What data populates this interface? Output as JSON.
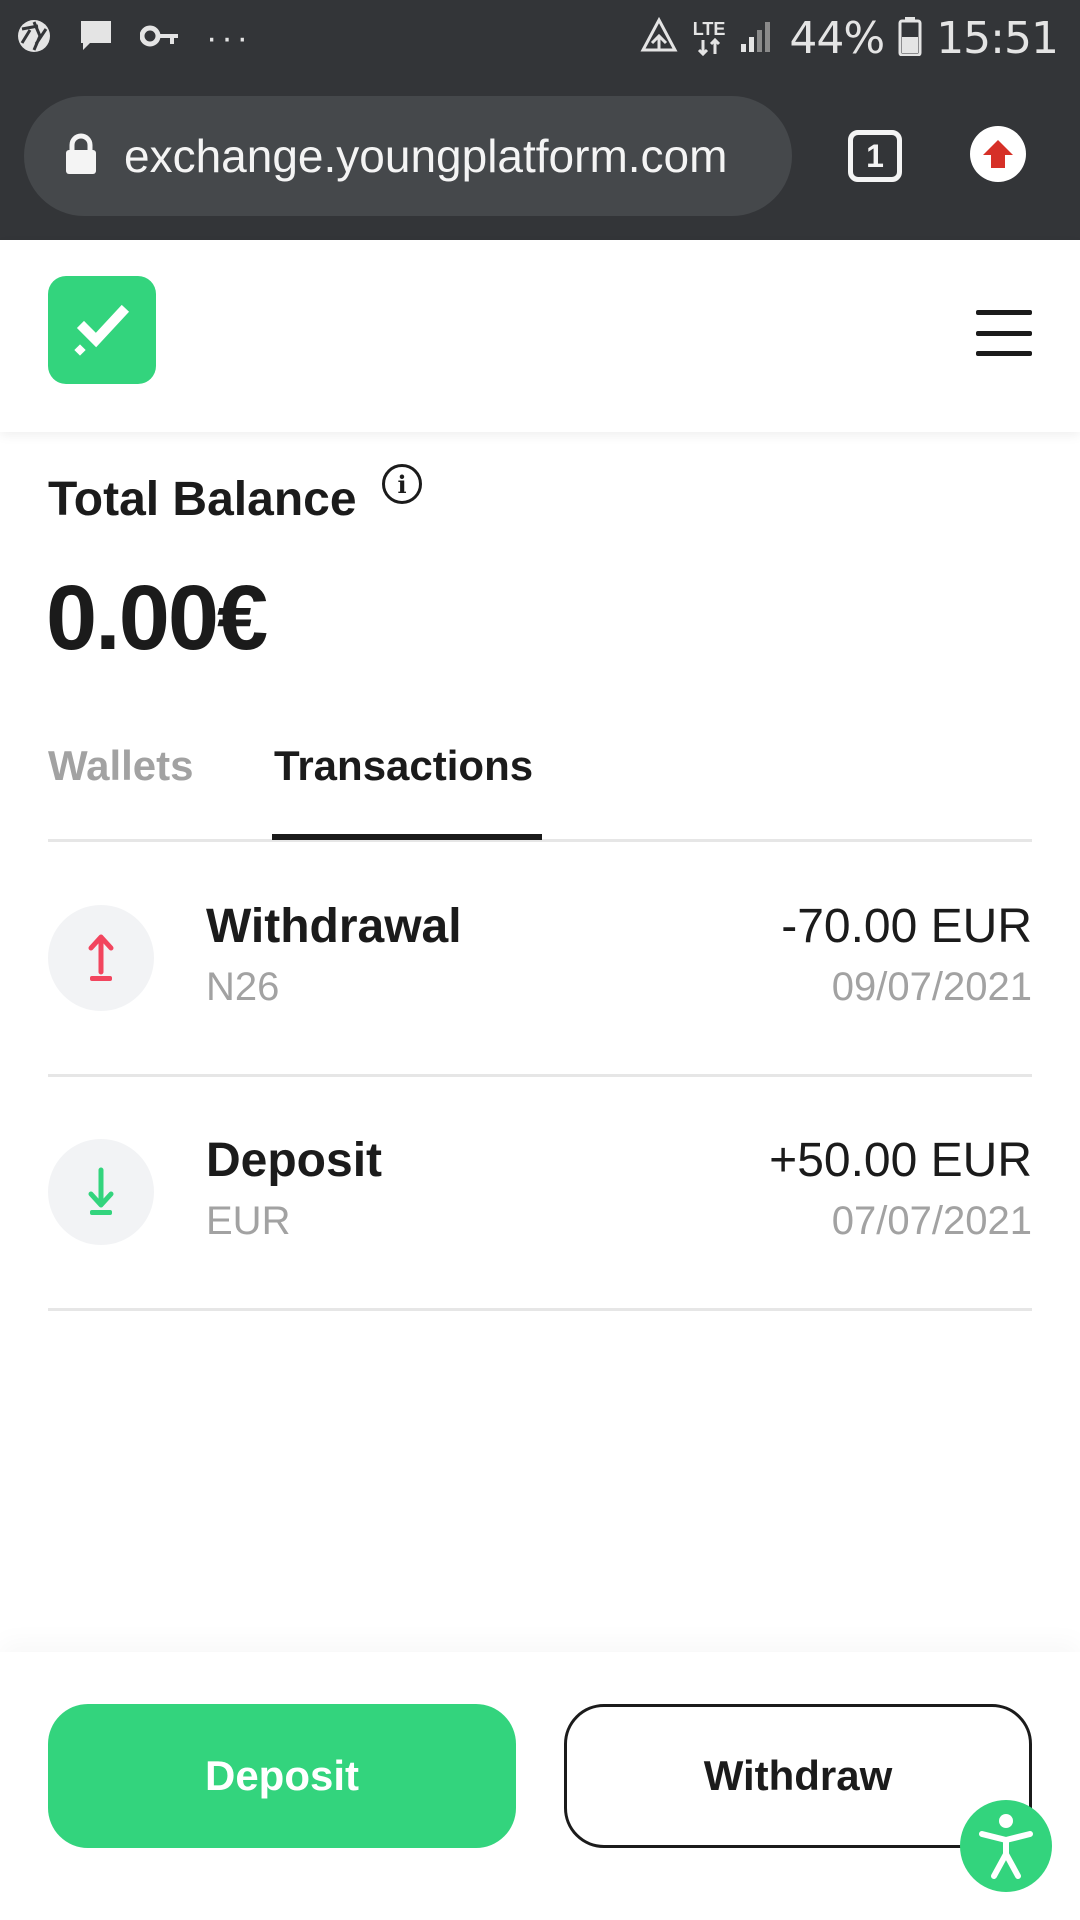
{
  "status_bar": {
    "icons": [
      "camera-aperture-icon",
      "message-icon",
      "vpn-key-icon",
      "more-dots-icon",
      "data-saver-icon",
      "lte-icon",
      "signal-icon",
      "battery-icon"
    ],
    "overflow": "···",
    "network": "LTE",
    "battery": "44%",
    "time": "15:51"
  },
  "browser": {
    "url": "exchange.youngplatform.com",
    "tab_count": "1",
    "icons": [
      "lock-icon",
      "update-arrow-icon"
    ]
  },
  "header": {
    "logo_icon": "checkmark-logo-icon",
    "menu_icon": "hamburger-menu-icon"
  },
  "balance": {
    "label": "Total Balance",
    "info_icon": "info-icon",
    "info_glyph": "i",
    "value": "0.00€"
  },
  "tabs": [
    {
      "label": "Wallets",
      "active": false
    },
    {
      "label": "Transactions",
      "active": true
    }
  ],
  "transactions": [
    {
      "type": "Withdrawal",
      "subtitle": "N26",
      "amount": "-70.00 EUR",
      "date": "09/07/2021",
      "icon": "arrow-up-icon",
      "icon_color": "#f2455e"
    },
    {
      "type": "Deposit",
      "subtitle": "EUR",
      "amount": "+50.00 EUR",
      "date": "07/07/2021",
      "icon": "arrow-down-icon",
      "icon_color": "#33d47d"
    }
  ],
  "actions": {
    "deposit_label": "Deposit",
    "withdraw_label": "Withdraw",
    "accessibility_icon": "accessibility-icon"
  },
  "colors": {
    "brand_green": "#33d47d",
    "withdraw_red": "#f2455e",
    "status_bar_bg": "#333538",
    "text_primary": "#1b1b1b",
    "text_muted": "#a2a2a2"
  }
}
